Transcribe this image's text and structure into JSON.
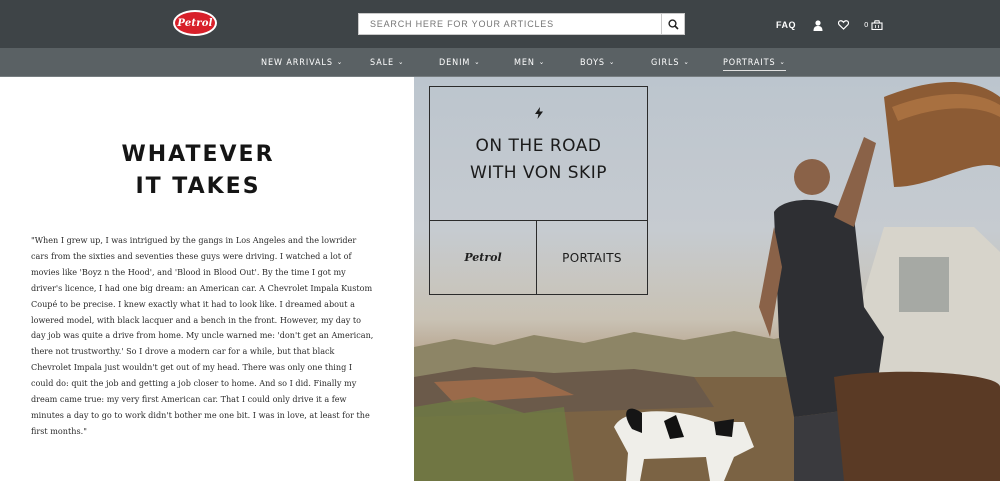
{
  "brand": {
    "logo_text": "Petrol",
    "colors": {
      "header": "#3e4447",
      "nav": "#5a6164",
      "logo": "#d8202a"
    }
  },
  "search": {
    "placeholder": "SEARCH HERE FOR YOUR ARTICLES",
    "button_icon": "search-icon"
  },
  "header_actions": {
    "faq_label": "FAQ",
    "account_icon": "user-icon",
    "wishlist_icon": "heart-icon",
    "cart_count": "0",
    "cart_icon": "cart-icon"
  },
  "nav": {
    "items": [
      {
        "label": "NEW ARRIVALS"
      },
      {
        "label": "SALE"
      },
      {
        "label": "DENIM"
      },
      {
        "label": "MEN"
      },
      {
        "label": "BOYS"
      },
      {
        "label": "GIRLS"
      },
      {
        "label": "PORTRAITS",
        "active": true
      }
    ]
  },
  "article": {
    "headline_line1": "WHATEVER",
    "headline_line2": "IT TAKES",
    "quote": "\"When I grew up, I was intrigued by the gangs in Los Angeles and the lowrider cars from the sixties and seventies these guys were driving. I watched a lot of movies like 'Boyz n the Hood', and 'Blood in Blood Out'. By the time I got my driver's licence, I had one big dream: an American car. A Chevrolet Impala Kustom Coupé to be precise. I knew exactly what it had to look like. I dreamed about a lowered model, with black lacquer and a bench in the front. However, my day to day job was quite a drive from home. My uncle warned me: 'don't get an American, there not trustworthy.' So I drove a modern car for a while, but that black Chevrolet Impala just wouldn't get out of my head. There was only one thing I could do: quit the job and getting a job closer to home. And so I did. Finally my dream came true: my very first American car. That I could only drive it a few minutes a day to go to work didn't bother me one bit. I was in love, at least for the first months.\""
  },
  "hero": {
    "title_line1": "ON THE ROAD",
    "title_line2": "WITH VON SKIP",
    "bolt_icon": "lightning-icon",
    "logo_word": "Petrol",
    "category": "PORTAITS"
  }
}
